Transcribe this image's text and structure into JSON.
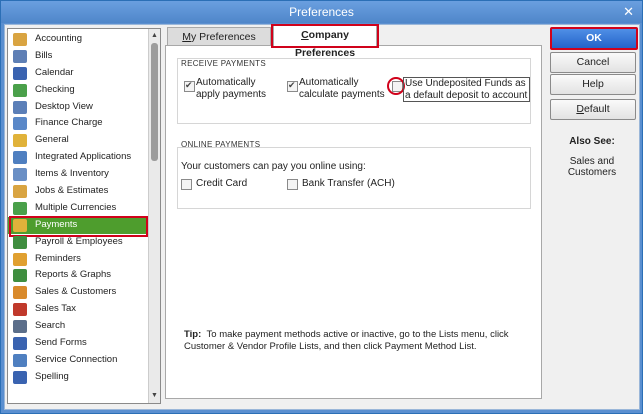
{
  "window": {
    "title": "Preferences",
    "close_glyph": "✕"
  },
  "sidebar": {
    "items": [
      {
        "label": "Accounting",
        "icon": "accounting-icon",
        "color": "#d9a441"
      },
      {
        "label": "Bills",
        "icon": "bills-icon",
        "color": "#5e7fb5"
      },
      {
        "label": "Calendar",
        "icon": "calendar-icon",
        "color": "#3a63b0"
      },
      {
        "label": "Checking",
        "icon": "checking-icon",
        "color": "#4aa04a"
      },
      {
        "label": "Desktop View",
        "icon": "desktop-view-icon",
        "color": "#5b7fb8"
      },
      {
        "label": "Finance Charge",
        "icon": "finance-charge-icon",
        "color": "#5a88c8"
      },
      {
        "label": "General",
        "icon": "general-icon",
        "color": "#e0b23a"
      },
      {
        "label": "Integrated Applications",
        "icon": "integrated-applications-icon",
        "color": "#4f7fc0"
      },
      {
        "label": "Items & Inventory",
        "icon": "items-inventory-icon",
        "color": "#6a8fc5"
      },
      {
        "label": "Jobs & Estimates",
        "icon": "jobs-estimates-icon",
        "color": "#d9a441"
      },
      {
        "label": "Multiple Currencies",
        "icon": "multiple-currencies-icon",
        "color": "#4aa04a"
      },
      {
        "label": "Payments",
        "icon": "payments-icon",
        "color": "#e0b23a",
        "selected": true
      },
      {
        "label": "Payroll & Employees",
        "icon": "payroll-employees-icon",
        "color": "#3f8e3f"
      },
      {
        "label": "Reminders",
        "icon": "reminders-icon",
        "color": "#e0a030"
      },
      {
        "label": "Reports & Graphs",
        "icon": "reports-graphs-icon",
        "color": "#3f8e3f"
      },
      {
        "label": "Sales & Customers",
        "icon": "sales-customers-icon",
        "color": "#d98a2b"
      },
      {
        "label": "Sales Tax",
        "icon": "sales-tax-icon",
        "color": "#c0392b"
      },
      {
        "label": "Search",
        "icon": "search-icon",
        "color": "#5b6e8a"
      },
      {
        "label": "Send Forms",
        "icon": "send-forms-icon",
        "color": "#3a63b0"
      },
      {
        "label": "Service Connection",
        "icon": "service-connection-icon",
        "color": "#4f7fc0"
      },
      {
        "label": "Spelling",
        "icon": "spelling-icon",
        "color": "#3a63b0"
      }
    ]
  },
  "tabs": {
    "my_prefix": "M",
    "my_rest": "y Preferences",
    "company_prefix": "C",
    "company_rest": "ompany Preferences"
  },
  "receive_payments": {
    "title": "RECEIVE PAYMENTS",
    "auto_apply": "Automatically apply payments",
    "auto_calc": "Automatically calculate payments",
    "undeposited": "Use Undeposited Funds as a default deposit to account"
  },
  "online_payments": {
    "title": "ONLINE PAYMENTS",
    "intro": "Your customers can pay you online using:",
    "credit_card": "Credit Card",
    "bank_transfer": "Bank Transfer (ACH)"
  },
  "tip": {
    "label": "Tip:",
    "text": "To make payment methods active or inactive, go to the Lists menu, click Customer & Vendor Profile Lists, and then click Payment Method List."
  },
  "buttons": {
    "ok": "OK",
    "cancel": "Cancel",
    "help": "Help",
    "default_prefix": "D",
    "default_rest": "efault"
  },
  "also_see": {
    "title": "Also See:",
    "link": "Sales and Customers"
  },
  "accent": {
    "selection": "#4e9d2d",
    "highlight": "#d0021b",
    "ok": "#2463c9"
  }
}
